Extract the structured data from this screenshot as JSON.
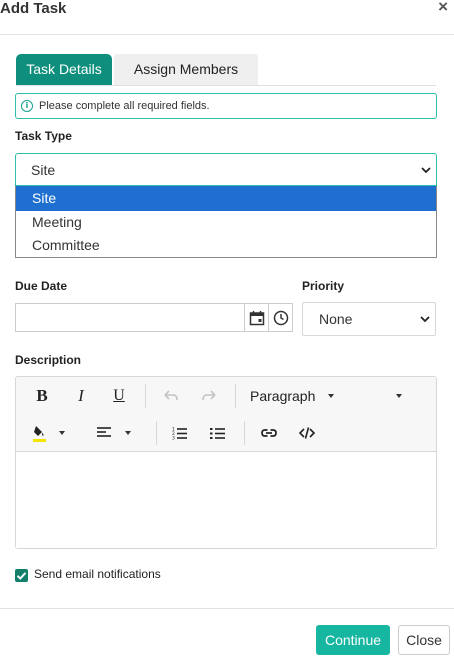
{
  "dialog": {
    "title": "Add Task",
    "close_glyph": "×"
  },
  "tabs": [
    {
      "label": "Task Details",
      "active": true
    },
    {
      "label": "Assign Members",
      "active": false
    }
  ],
  "alert": {
    "icon": "info-icon",
    "text": "Please complete all required fields."
  },
  "task_type": {
    "label": "Task Type",
    "value": "Site",
    "options": [
      {
        "label": "Site",
        "selected": true
      },
      {
        "label": "Meeting",
        "selected": false
      },
      {
        "label": "Committee",
        "selected": false
      }
    ]
  },
  "due_date": {
    "label": "Due Date",
    "value": "",
    "icons": [
      "calendar-icon",
      "clock-icon"
    ]
  },
  "priority": {
    "label": "Priority",
    "value": "None"
  },
  "description": {
    "label": "Description",
    "toolbar": {
      "bold": "B",
      "italic": "I",
      "underline": "U",
      "block_format": "Paragraph",
      "icons": [
        "undo-icon",
        "redo-icon",
        "highlight-color-icon",
        "align-icon",
        "numbered-list-icon",
        "bulleted-list-icon",
        "link-icon",
        "source-code-icon"
      ]
    },
    "content": ""
  },
  "notifications": {
    "label": "Send email notifications",
    "checked": true
  },
  "footer": {
    "continue_label": "Continue",
    "close_label": "Close"
  },
  "colors": {
    "accent": "#0e8f7e",
    "accent_light": "#17b6a0",
    "selected_option": "#1f6fd1",
    "focus_border": "#2bbfae",
    "highlight_yellow": "#f2e600"
  }
}
